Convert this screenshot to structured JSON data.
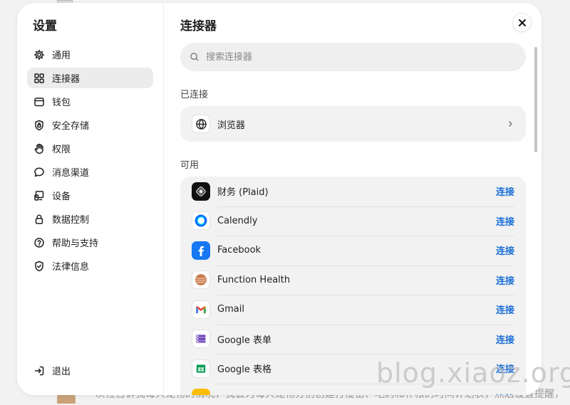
{
  "background": {
    "text": "一次性告诉我每只宠物的情况，我会为每只宠物分别创建打疫苗、吃药和补粮的时间计划表，然后设置提醒，"
  },
  "sidebar": {
    "title": "设置",
    "items": [
      {
        "label": "通用",
        "icon": "gear-icon"
      },
      {
        "label": "连接器",
        "icon": "grid-icon"
      },
      {
        "label": "钱包",
        "icon": "wallet-icon"
      },
      {
        "label": "安全存储",
        "icon": "shield-lock-icon"
      },
      {
        "label": "权限",
        "icon": "hand-icon"
      },
      {
        "label": "消息渠道",
        "icon": "chat-bubble-icon"
      },
      {
        "label": "设备",
        "icon": "devices-icon"
      },
      {
        "label": "数据控制",
        "icon": "lock-icon"
      },
      {
        "label": "帮助与支持",
        "icon": "help-circle-icon"
      },
      {
        "label": "法律信息",
        "icon": "shield-check-icon"
      }
    ],
    "active_index": 1,
    "logout_label": "退出"
  },
  "main": {
    "title": "连接器",
    "search_placeholder": "搜索连接器",
    "connected_label": "已连接",
    "connected": [
      {
        "name": "浏览器",
        "icon": "globe-icon"
      }
    ],
    "available_label": "可用",
    "connect_label": "连接",
    "available": [
      {
        "name": "财务 (Plaid)",
        "icon": "plaid-icon"
      },
      {
        "name": "Calendly",
        "icon": "calendly-icon"
      },
      {
        "name": "Facebook",
        "icon": "facebook-icon"
      },
      {
        "name": "Function Health",
        "icon": "function-health-icon"
      },
      {
        "name": "Gmail",
        "icon": "gmail-icon"
      },
      {
        "name": "Google 表单",
        "icon": "google-forms-icon"
      },
      {
        "name": "Google 表格",
        "icon": "google-sheets-icon"
      },
      {
        "name": "",
        "icon": "partial-yellow-icon"
      }
    ]
  },
  "watermark": "blog.xiaoz.org",
  "colors": {
    "accent": "#1a6fd6",
    "active_bg": "#ececec",
    "card_bg": "#f2f2f2"
  }
}
